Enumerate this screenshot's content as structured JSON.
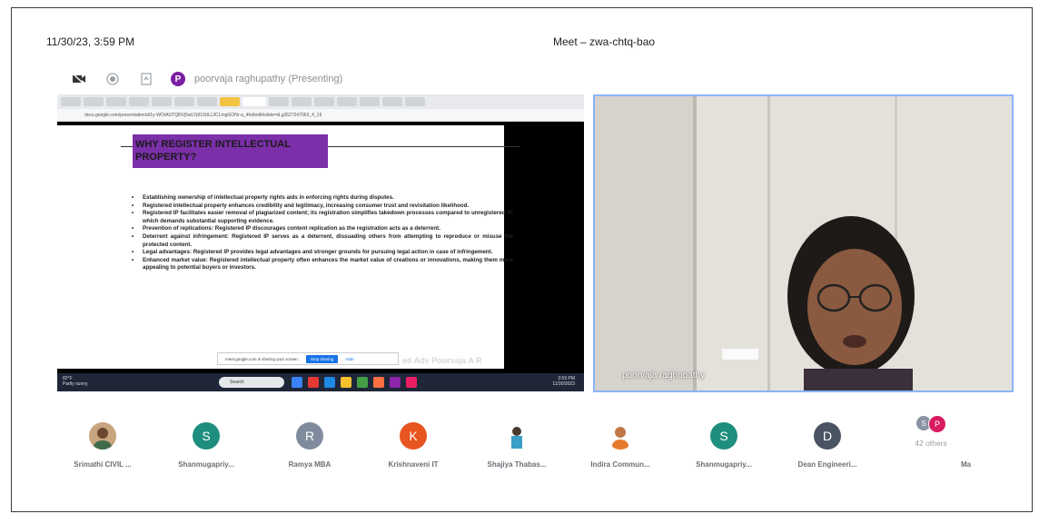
{
  "header": {
    "timestamp": "11/30/23, 3:59 PM",
    "window_title": "Meet – zwa-chtq-bao"
  },
  "toolbar": {
    "presenter_initial": "P",
    "presenter_label": "poorvaja raghupathy (Presenting)"
  },
  "shared_screen": {
    "url": "docs.google.com/presentation/d/1y-WOtAUTQRVj5wLYj81XtlLL3CLmgGONr-a_4hd/edit#slide=id.g2627247063_4_19",
    "slide": {
      "title": "WHY REGISTER INTELLECTUAL PROPERTY?",
      "bullets": [
        "Establishing ownership of intellectual property rights aids in enforcing rights during disputes.",
        "Registered intellectual property enhances credibility and legitimacy, increasing consumer trust and revisitation likelihood.",
        "Registered IP facilitates easier removal of plagiarized content; its registration simplifies takedown processes compared to unregistered IP, which demands substantial supporting evidence.",
        "Prevention of replications: Registered IP discourages content replication as the registration acts as a deterrent.",
        "Deterrent against infringement: Registered IP serves as a deterrent, dissuading others from attempting to reproduce or misuse the protected content.",
        "Legal advantages: Registered IP provides legal advantages and stronger grounds for pursuing legal action in case of infringement.",
        "Enhanced market value: Registered intellectual property often enhances the market value of creations or innovations, making them more appealing to potential buyers or investors."
      ]
    },
    "share_notice": "meet.google.com is sharing your screen.",
    "stop_sharing": "Stop sharing",
    "hide": "Hide",
    "watermark": "ed Adv Poorvaja A R",
    "taskbar": {
      "weather_temp": "82°F",
      "weather_desc": "Partly sunny",
      "search_placeholder": "Search",
      "clock_time": "3:59 PM",
      "clock_date": "11/30/2023"
    }
  },
  "camera": {
    "name": "poorvaja raghupathy"
  },
  "participants": [
    {
      "name": "Srimathi CIVIL ...",
      "initial": "",
      "color": "#c9a27a",
      "photo": true
    },
    {
      "name": "Shanmugapriy...",
      "initial": "S",
      "color": "#1e8e7e"
    },
    {
      "name": "Ramya MBA",
      "initial": "R",
      "color": "#7f8c9d"
    },
    {
      "name": "Krishnaveni IT",
      "initial": "K",
      "color": "#e8541f"
    },
    {
      "name": "Shajiya Thabas...",
      "initial": "",
      "color": "#cfd8dc",
      "photo": true
    },
    {
      "name": "Indira Commun...",
      "initial": "",
      "color": "#f0b58a",
      "photo": true
    },
    {
      "name": "Shanmugapriy...",
      "initial": "S",
      "color": "#1e8e7e"
    },
    {
      "name": "Dean Engineeri...",
      "initial": "D",
      "color": "#4a5361"
    },
    {
      "name": "42 others",
      "initial": "S",
      "initial2": "P",
      "color": "#8a93a3",
      "color2": "#d81b60"
    },
    {
      "name": "Ma",
      "initial": "",
      "color": "#ffffff"
    }
  ]
}
